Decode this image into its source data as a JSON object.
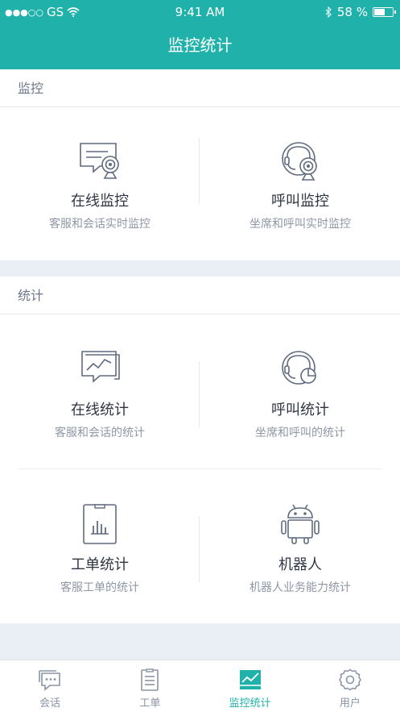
{
  "status": {
    "carrier": "GS",
    "time": "9:41 AM",
    "battery": "58 %"
  },
  "header": {
    "title": "监控统计"
  },
  "sections": [
    {
      "label": "监控"
    },
    {
      "label": "统计"
    }
  ],
  "monitor": {
    "online": {
      "title": "在线监控",
      "sub": "客服和会话实时监控"
    },
    "call": {
      "title": "呼叫监控",
      "sub": "坐席和呼叫实时监控"
    }
  },
  "stats": {
    "online": {
      "title": "在线统计",
      "sub": "客服和会话的统计"
    },
    "call": {
      "title": "呼叫统计",
      "sub": "坐席和呼叫的统计"
    },
    "ticket": {
      "title": "工单统计",
      "sub": "客服工单的统计"
    },
    "robot": {
      "title": "机器人",
      "sub": "机器人业务能力统计"
    }
  },
  "tabs": [
    {
      "label": "会话",
      "icon": "chat-icon"
    },
    {
      "label": "工单",
      "icon": "clipboard-icon"
    },
    {
      "label": "监控统计",
      "icon": "chart-icon",
      "active": true
    },
    {
      "label": "用户",
      "icon": "gear-icon"
    }
  ],
  "colors": {
    "brand": "#20b2aa",
    "text": "#303643",
    "muted": "#8f97a6"
  }
}
